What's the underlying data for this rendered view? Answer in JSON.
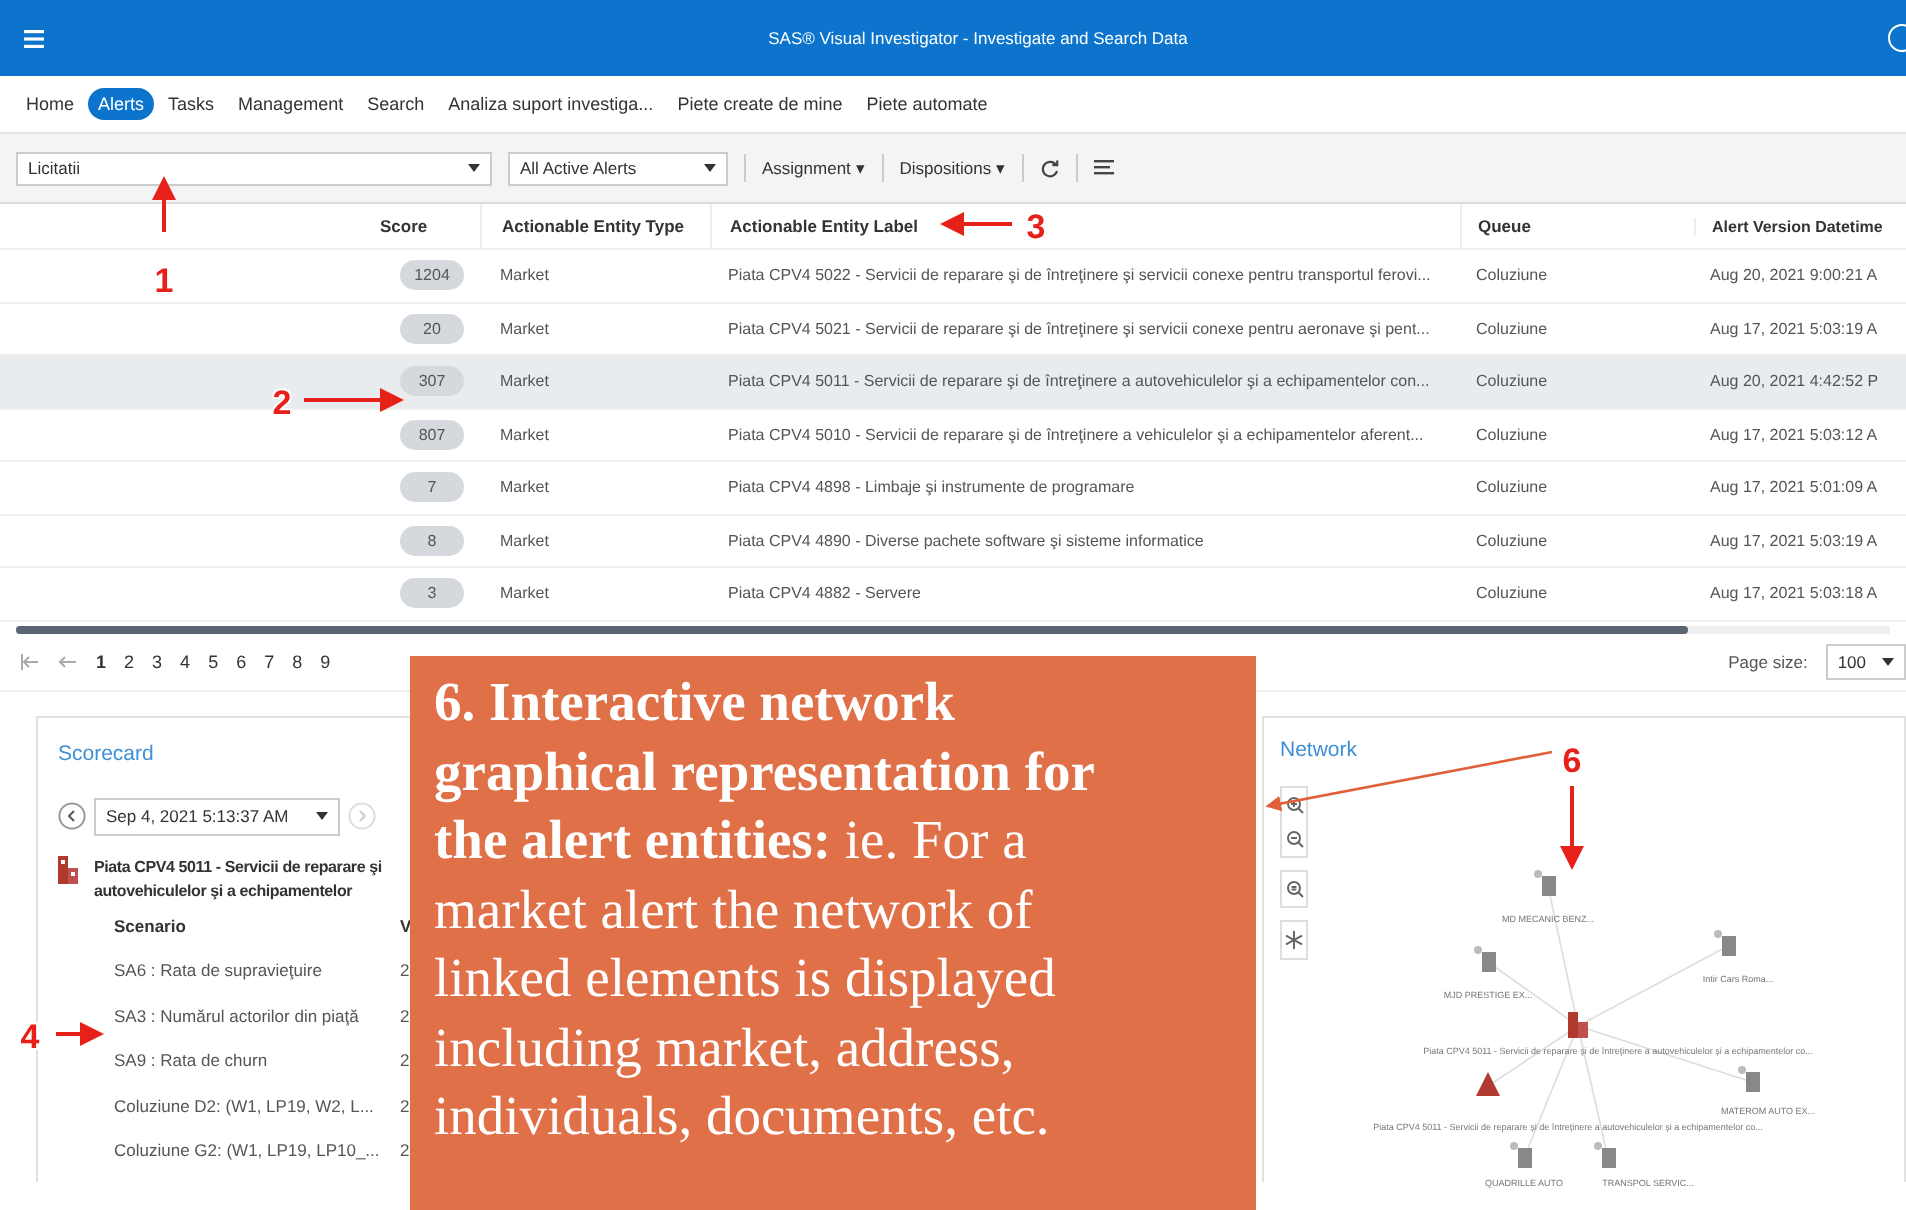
{
  "window": {
    "title": "SAS® Visual Investigator - Investigate and Search Data"
  },
  "tabs": [
    {
      "label": "Home",
      "selected": false
    },
    {
      "label": "Alerts",
      "selected": true
    },
    {
      "label": "Tasks",
      "selected": false
    },
    {
      "label": "Management",
      "selected": false
    },
    {
      "label": "Search",
      "selected": false
    },
    {
      "label": "Analiza suport investiga...",
      "selected": false
    },
    {
      "label": "Piete create de mine",
      "selected": false
    },
    {
      "label": "Piete automate",
      "selected": false
    }
  ],
  "toolbar": {
    "queue_select": "Licitatii",
    "filter_select": "All Active Alerts",
    "assignment": "Assignment ▾",
    "dispositions": "Dispositions ▾"
  },
  "table": {
    "columns": [
      "Score",
      "Actionable Entity Type",
      "Actionable Entity Label",
      "Queue",
      "Alert Version Datetime"
    ],
    "rows": [
      {
        "score": "1204",
        "type": "Market",
        "label": "Piata CPV4 5022 - Servicii de reparare şi de întreţinere şi servicii conexe pentru transportul ferovi...",
        "queue": "Coluziune",
        "datetime": "Aug 20, 2021 9:00:21 A",
        "selected": false
      },
      {
        "score": "20",
        "type": "Market",
        "label": "Piata CPV4 5021 - Servicii de reparare şi de întreţinere şi servicii conexe pentru aeronave şi pent...",
        "queue": "Coluziune",
        "datetime": "Aug 17, 2021 5:03:19 A",
        "selected": false
      },
      {
        "score": "307",
        "type": "Market",
        "label": "Piata CPV4 5011 - Servicii de reparare şi de întreţinere a autovehiculelor şi a echipamentelor con...",
        "queue": "Coluziune",
        "datetime": "Aug 20, 2021 4:42:52 P",
        "selected": true
      },
      {
        "score": "807",
        "type": "Market",
        "label": "Piata CPV4 5010 - Servicii de reparare şi de întreţinere a vehiculelor şi a echipamentelor aferent...",
        "queue": "Coluziune",
        "datetime": "Aug 17, 2021 5:03:12 A",
        "selected": false
      },
      {
        "score": "7",
        "type": "Market",
        "label": "Piata CPV4 4898 - Limbaje şi instrumente de programare",
        "queue": "Coluziune",
        "datetime": "Aug 17, 2021 5:01:09 A",
        "selected": false
      },
      {
        "score": "8",
        "type": "Market",
        "label": "Piata CPV4 4890 - Diverse pachete software şi sisteme informatice",
        "queue": "Coluziune",
        "datetime": "Aug 17, 2021 5:03:19 A",
        "selected": false
      },
      {
        "score": "3",
        "type": "Market",
        "label": "Piata CPV4 4882 - Servere",
        "queue": "Coluziune",
        "datetime": "Aug 17, 2021 5:03:18 A",
        "selected": false
      }
    ]
  },
  "pagination": {
    "pages": [
      {
        "label": "1",
        "selected": true
      },
      {
        "label": "2",
        "selected": false
      },
      {
        "label": "3",
        "selected": false
      },
      {
        "label": "4",
        "selected": false
      },
      {
        "label": "5",
        "selected": false
      },
      {
        "label": "6",
        "selected": false
      },
      {
        "label": "7",
        "selected": false
      },
      {
        "label": "8",
        "selected": false
      },
      {
        "label": "9",
        "selected": false
      }
    ],
    "page_size_label": "Page size:",
    "page_size": "100"
  },
  "scorecard": {
    "title": "Scorecard",
    "date": "Sep 4, 2021 5:13:37 AM",
    "entity_line1": "Piata CPV4 5011 - Servicii de reparare şi",
    "entity_line2": "autovehiculelor şi a echipamentelor",
    "columns": [
      "Scenario",
      "V"
    ],
    "rows": [
      {
        "scenario": "SA6 : Rata de supravieţuire",
        "value": "2"
      },
      {
        "scenario": "SA3 : Numărul actorilor din piaţă",
        "value": "2"
      },
      {
        "scenario": "SA9 : Rata de churn",
        "value": "2"
      },
      {
        "scenario": "Coluziune D2: (W1, LP19, W2, L...",
        "value": "2"
      },
      {
        "scenario": "Coluziune G2: (W1, LP19, LP10_...",
        "value": "2"
      }
    ]
  },
  "network": {
    "title": "Network",
    "nodes": [
      {
        "kind": "entity",
        "label": "MD MECANIC BENZ..."
      },
      {
        "kind": "entity",
        "label": "Intir Cars Roma..."
      },
      {
        "kind": "entity",
        "label": "MJD PRESTIGE EX..."
      },
      {
        "kind": "market",
        "label": "Piata CPV4 5011 - Servicii de reparare şi de întreţinere a autovehiculelor şi a echipamentelor co..."
      },
      {
        "kind": "entity",
        "label": "MATEROM AUTO EX..."
      },
      {
        "kind": "alert",
        "label": "Piata CPV4 5011 - Servicii de reparare şi de întreţinere a autovehiculelor şi a echipamentelor co..."
      },
      {
        "kind": "entity",
        "label": "QUADRILLE AUTO"
      },
      {
        "kind": "entity",
        "label": "TRANSPOL SERVIC..."
      }
    ]
  },
  "callout": {
    "text": "**6. Interactive network graphical representation for the alert entities:** ie. For a market alert the network of linked elements is displayed including market, address, individuals, documents, etc."
  },
  "annotations": [
    "1",
    "2",
    "3",
    "4",
    "6"
  ]
}
